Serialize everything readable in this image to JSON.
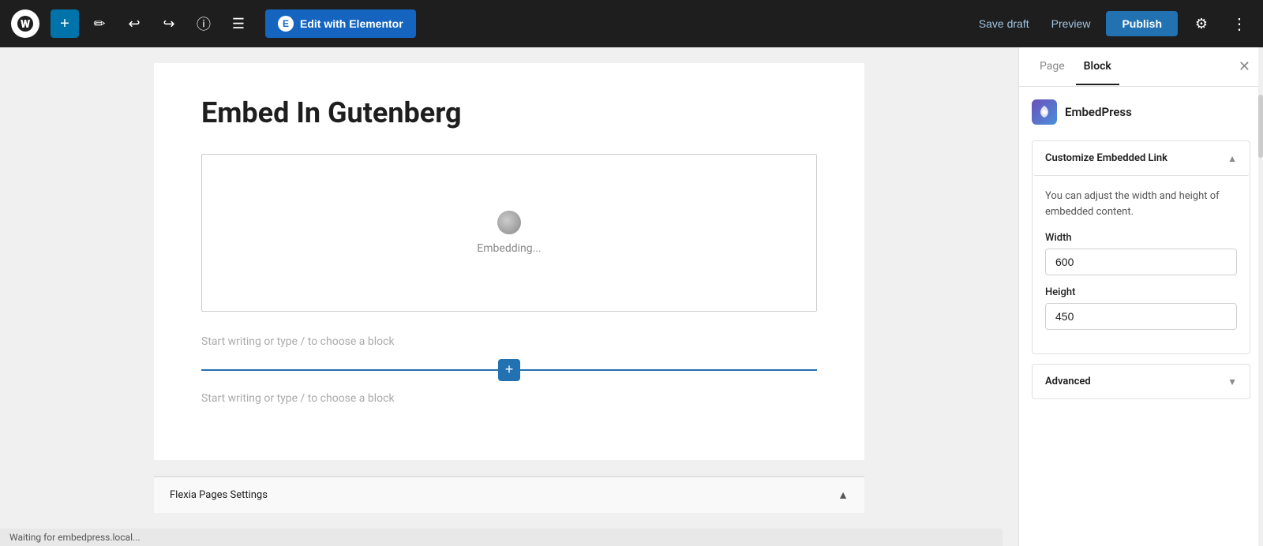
{
  "toolbar": {
    "add_label": "+",
    "elementor_label": "Edit with Elementor",
    "save_draft_label": "Save draft",
    "preview_label": "Preview",
    "publish_label": "Publish"
  },
  "editor": {
    "page_title": "Embed In Gutenberg",
    "embed_loading_text": "Embedding...",
    "block_placeholder_1": "Start writing or type / to choose a block",
    "block_placeholder_2": "Start writing or type / to choose a block"
  },
  "flexia": {
    "settings_label": "Flexia Pages Settings"
  },
  "status_bar": {
    "text": "Waiting for embedpress.local..."
  },
  "sidebar": {
    "page_tab": "Page",
    "block_tab": "Block",
    "plugin_name": "EmbedPress",
    "customize_section": {
      "title": "Customize Embedded Link",
      "description": "You can adjust the width and height of embedded content.",
      "width_label": "Width",
      "width_value": "600",
      "height_label": "Height",
      "height_value": "450"
    },
    "advanced_section": {
      "title": "Advanced"
    }
  }
}
